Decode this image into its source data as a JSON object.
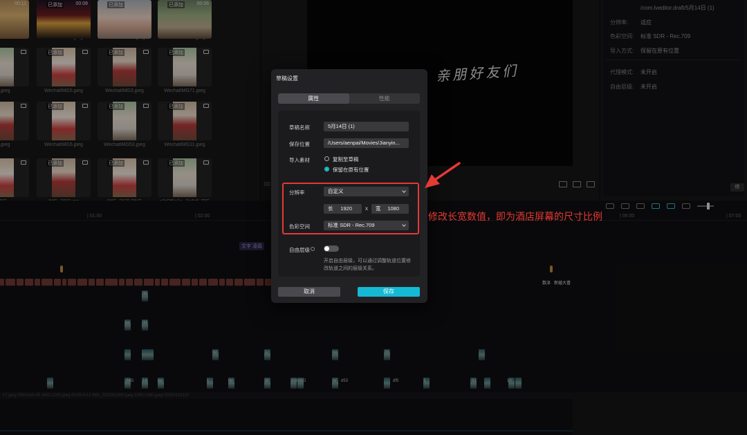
{
  "media": {
    "items": [
      {
        "badge": "",
        "filename": "",
        "duration": "",
        "kind": "photo"
      },
      {
        "badge": "已添加",
        "filename": "WechatIMG5.jpeg",
        "duration": "",
        "kind": "photo"
      },
      {
        "badge": "已添加",
        "filename": "WechatIMG61.jpeg",
        "duration": "",
        "kind": "photo"
      },
      {
        "badge": "已添加",
        "filename": "WechatIMG70.jpeg",
        "duration": "",
        "kind": "photo"
      },
      {
        "badge": "",
        "filename": "62.jpeg",
        "duration": "",
        "kind": "photo"
      },
      {
        "badge": "已添加",
        "filename": "WechatIMG5.jpeg",
        "duration": "",
        "kind": "photo"
      },
      {
        "badge": "已添加",
        "filename": "WechatIMG3.jpeg",
        "duration": "",
        "kind": "photo"
      },
      {
        "badge": "已添加",
        "filename": "WechatIMG71.jpeg",
        "duration": "",
        "kind": "photo"
      },
      {
        "badge": "",
        "filename": "34.jpeg",
        "duration": "",
        "kind": "photo"
      },
      {
        "badge": "已添加",
        "filename": "WechatIMG5.jpeg",
        "duration": "",
        "kind": "photo"
      },
      {
        "badge": "已添加",
        "filename": "WechatIMG53.jpeg",
        "duration": "",
        "kind": "photo"
      },
      {
        "badge": "已添加",
        "filename": "WechatIMG11.jpeg",
        "duration": "",
        "kind": "photo"
      },
      {
        "badge": "",
        "filename": "JPG",
        "duration": "",
        "kind": "photo"
      },
      {
        "badge": "已添加",
        "filename": "IMG_2682.jpg",
        "duration": "",
        "kind": "photo"
      },
      {
        "badge": "已添加",
        "filename": "IMG_2578.PNG",
        "duration": "",
        "kind": "photo"
      },
      {
        "badge": "已添加",
        "filename": "a8d3f5a1c...5c6c5.JPG",
        "duration": "",
        "kind": "photo"
      },
      {
        "badge": "",
        "filename": "",
        "duration": "00:11",
        "kind": "video"
      },
      {
        "badge": "已添加",
        "filename": "",
        "duration": "00:08",
        "kind": "video"
      },
      {
        "badge": "已添加",
        "filename": "",
        "duration": "",
        "kind": "video"
      },
      {
        "badge": "已添加",
        "filename": "",
        "duration": "00:06",
        "kind": "video"
      }
    ]
  },
  "preview": {
    "canvas_text": "亲朋好友们",
    "left_label": "00"
  },
  "properties": {
    "rows": [
      {
        "key": "",
        "value": "/com.lveditor.draft/5月14日 (1)"
      },
      {
        "key": "分辨率:",
        "value": "适应"
      },
      {
        "key": "色彩空间:",
        "value": "标准 SDR - Rec.709"
      },
      {
        "key": "导入方式:",
        "value": "保留在原有位置"
      },
      {
        "key": "代理模式:",
        "value": "未开启"
      },
      {
        "key": "自由层级:",
        "value": "未开启"
      }
    ],
    "button": "修"
  },
  "timeline": {
    "ticks": [
      "| 01:00",
      "| 02:00",
      "| 06:00",
      "| 07:00"
    ],
    "text_track_tag": "文字 凌霜",
    "strip_tags": [
      "数泽",
      "新婚大喜"
    ],
    "mini_labels": [
      "IM",
      "be",
      "IM",
      "IM",
      "1(",
      "be",
      "35",
      "IMG",
      "16",
      "be",
      "1",
      "IM",
      "W",
      "898",
      "IMG",
      "W",
      "d53",
      "df5",
      "3",
      "91",
      "10"
    ],
    "bottom_text": "17.jpeg   00001A0-00   1692-1000.jpeg   00:00:4:12   IMG_SD0001000.jpeg   1000:1000.jpeg   00000110110"
  },
  "dialog": {
    "title": "草稿设置",
    "tabs": [
      "属性",
      "性能"
    ],
    "active_tab": 0,
    "name_label": "草稿名称",
    "name_value": "5月14日 (1)",
    "path_label": "保存位置",
    "path_value": "/Users/aenpai/Movies/Jianyin...",
    "import_label": "导入素材",
    "import_options": [
      "复制至草稿",
      "保留在原有位置"
    ],
    "import_selected": 1,
    "resolution_label": "分辨率",
    "resolution_value": "自定义",
    "width_key": "长",
    "width_value": "1920",
    "times": "x",
    "height_key": "宽",
    "height_value": "1080",
    "color_label": "色彩空间",
    "color_value": "标准 SDR - Rec.709",
    "layer_label": "自由层级",
    "layer_enabled": false,
    "layer_desc": "开启自由层级，可以通过调整轨道位置修改轨道之间的层级关系。",
    "cancel": "取消",
    "save": "保存"
  },
  "annotation": {
    "text": "修改长宽数值，即为酒店屏幕的尺寸比例",
    "color": "#e43a33"
  },
  "colors": {
    "accent": "#16b9d4",
    "highlight": "#e43a33"
  }
}
